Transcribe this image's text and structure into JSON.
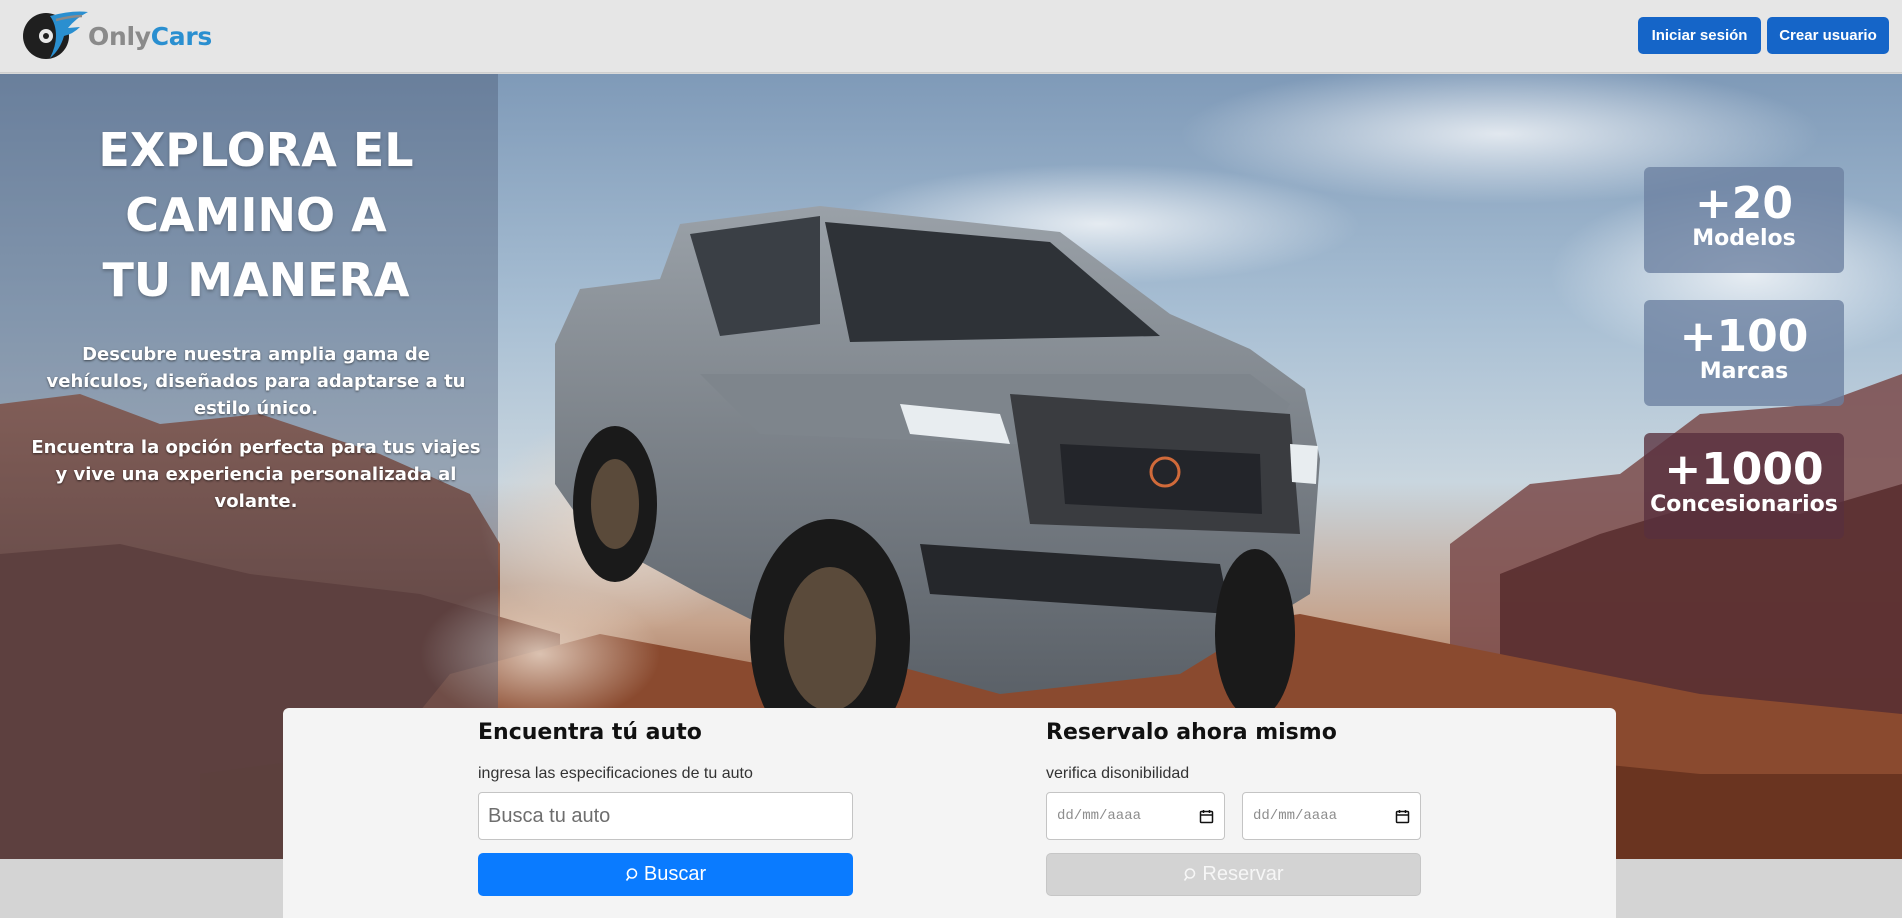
{
  "header": {
    "logo": {
      "name_part1": "Only",
      "name_part2": "Cars"
    },
    "login_button": "Iniciar sesión",
    "register_button": "Crear usuario"
  },
  "hero": {
    "headline": [
      "EXPLORA EL",
      "CAMINO A",
      "TU MANERA"
    ],
    "description_1": "Descubre nuestra amplia gama de vehículos, diseñados para adaptarse a tu estilo único.",
    "description_2": "Encuentra la opción perfecta para tus viajes y vive una experiencia personalizada al volante.",
    "stats": [
      {
        "value": "+20",
        "label": "Modelos"
      },
      {
        "value": "+100",
        "label": "Marcas"
      },
      {
        "value": "+1000",
        "label": "Concesionarios"
      }
    ]
  },
  "search": {
    "title": "Encuentra tú auto",
    "subtitle": "ingresa las especificaciones de tu auto",
    "placeholder": "Busca tu auto",
    "button": "Buscar"
  },
  "reserve": {
    "title": "Reservalo ahora mismo",
    "subtitle": "verifica disonibilidad",
    "date_placeholder_1": "dd/mm/aaaa",
    "date_placeholder_2": "dd/mm/aaaa",
    "button": "Reservar"
  },
  "colors": {
    "header_bg": "#e6e6e6",
    "primary_button": "#1565c8",
    "search_button": "#0a7bff",
    "reserve_button_disabled": "#d3d3d3",
    "logo_blue": "#2a8fd0"
  }
}
